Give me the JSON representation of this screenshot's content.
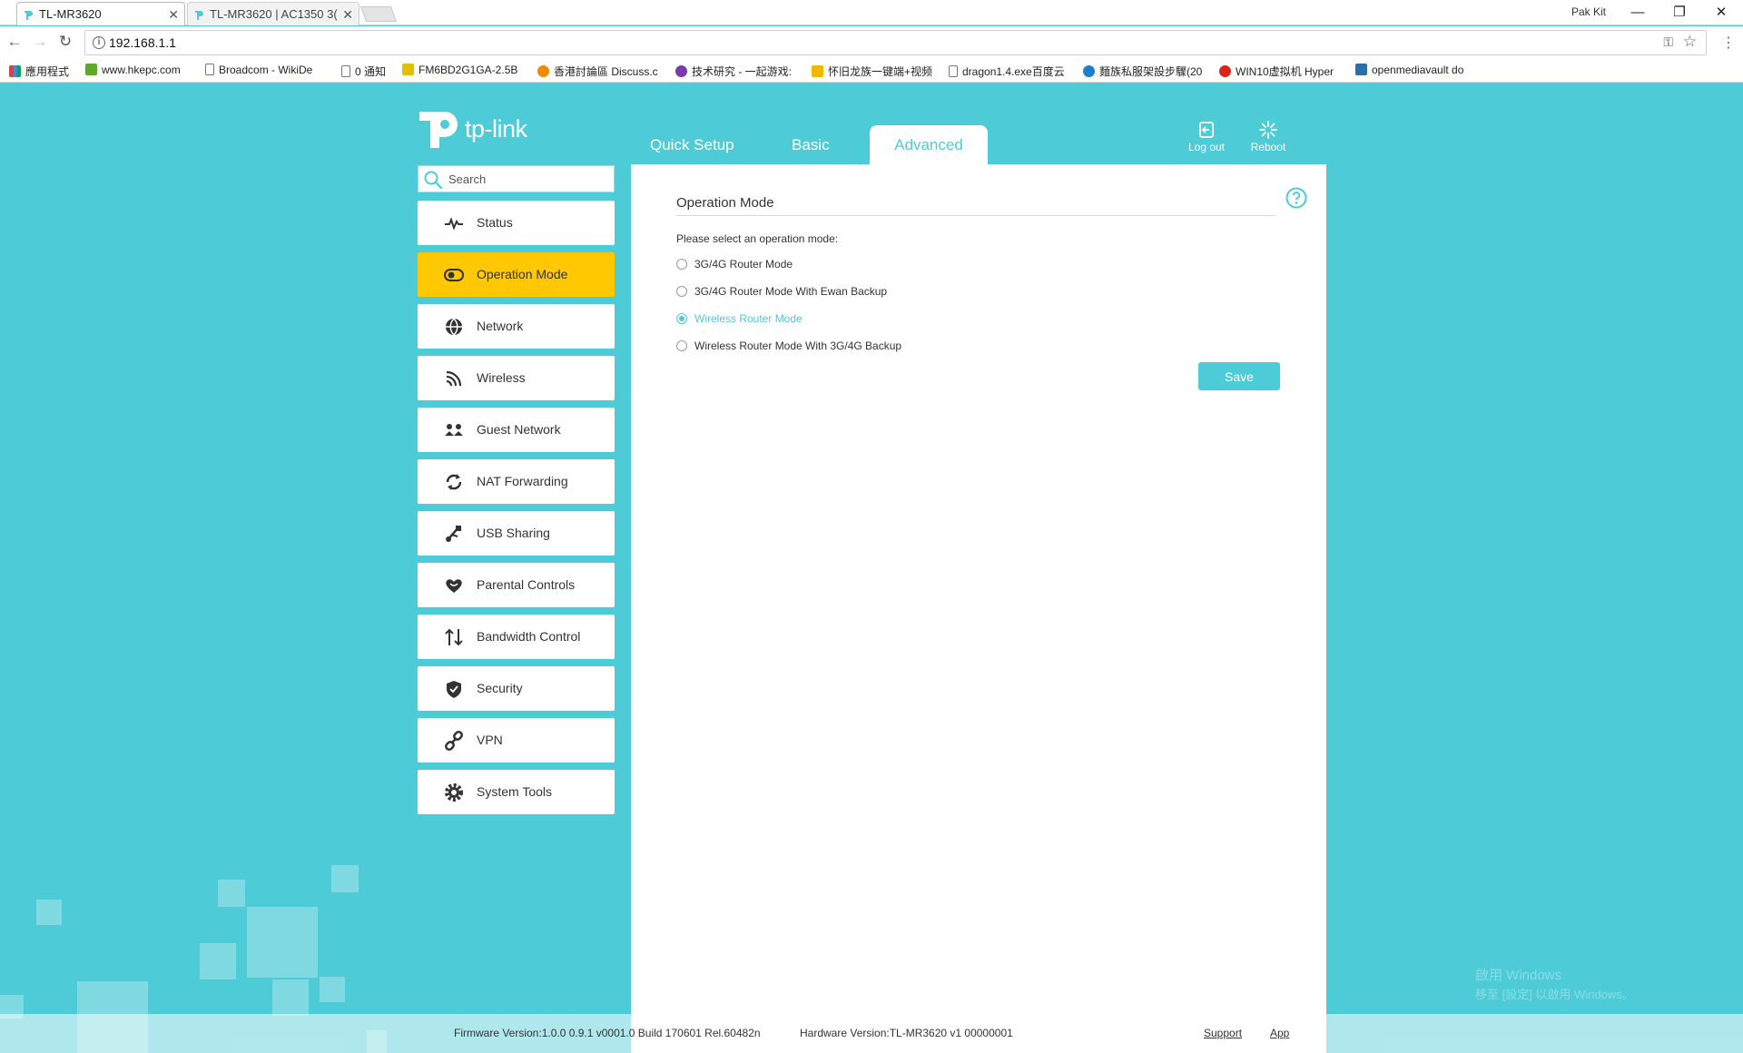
{
  "browser": {
    "tabs": [
      {
        "title": "TL-MR3620",
        "active": true
      },
      {
        "title": "TL-MR3620 | AC1350 3(",
        "active": false
      }
    ],
    "user": "Pak Kit",
    "url": "192.168.1.1",
    "bookmarks": [
      {
        "label": "應用程式",
        "icon": "apps-grid-icon",
        "color": "#d14836"
      },
      {
        "label": "www.hkepc.com",
        "icon": "hkepc-icon",
        "color": "#5fa82e"
      },
      {
        "label": "Broadcom - WikiDe",
        "icon": "page-icon",
        "color": "#ffffff"
      },
      {
        "label": "0 通知",
        "icon": "page-icon",
        "color": "#ffffff"
      },
      {
        "label": "FM6BD2G1GA-2.5B",
        "icon": "chip-icon",
        "color": "#e0c000"
      },
      {
        "label": "香港討論區 Discuss.c",
        "icon": "discuss-icon",
        "color": "#f08a00"
      },
      {
        "label": "技术研究 - 一起游戏:",
        "icon": "game-icon",
        "color": "#7a3aa8"
      },
      {
        "label": "怀旧龙族一键端+视频",
        "icon": "dragon-icon",
        "color": "#f0b800"
      },
      {
        "label": "dragon1.4.exe百度云",
        "icon": "page-icon",
        "color": "#ffffff"
      },
      {
        "label": "麵族私服架設步驟(20",
        "icon": "puzzle-icon",
        "color": "#1a7fd1"
      },
      {
        "label": "WIN10虚拟机 Hyper",
        "icon": "weibo-icon",
        "color": "#d9261c"
      },
      {
        "label": "openmediavault do",
        "icon": "sf-icon",
        "color": "#2a6ea8"
      }
    ]
  },
  "header": {
    "brand": "tp-link",
    "nav": {
      "quick_setup": "Quick Setup",
      "basic": "Basic",
      "advanced": "Advanced"
    },
    "logout": "Log out",
    "reboot": "Reboot"
  },
  "search": {
    "placeholder": "Search"
  },
  "sidebar": {
    "items": [
      {
        "label": "Status",
        "icon": "pulse-icon",
        "active": false
      },
      {
        "label": "Operation Mode",
        "icon": "toggle-icon",
        "active": true
      },
      {
        "label": "Network",
        "icon": "globe-icon",
        "active": false
      },
      {
        "label": "Wireless",
        "icon": "wifi-icon",
        "active": false
      },
      {
        "label": "Guest Network",
        "icon": "guest-icon",
        "active": false
      },
      {
        "label": "NAT Forwarding",
        "icon": "nat-icon",
        "active": false
      },
      {
        "label": "USB Sharing",
        "icon": "usb-icon",
        "active": false
      },
      {
        "label": "Parental Controls",
        "icon": "heart-icon",
        "active": false
      },
      {
        "label": "Bandwidth Control",
        "icon": "bandwidth-icon",
        "active": false
      },
      {
        "label": "Security",
        "icon": "shield-icon",
        "active": false
      },
      {
        "label": "VPN",
        "icon": "link-icon",
        "active": false
      },
      {
        "label": "System Tools",
        "icon": "gear-icon",
        "active": false
      }
    ]
  },
  "main": {
    "title": "Operation Mode",
    "prompt": "Please select an operation mode:",
    "options": [
      {
        "label": "3G/4G Router Mode",
        "checked": false
      },
      {
        "label": "3G/4G Router Mode With Ewan Backup",
        "checked": false
      },
      {
        "label": "Wireless Router Mode",
        "checked": true
      },
      {
        "label": "Wireless Router Mode With 3G/4G Backup",
        "checked": false
      }
    ],
    "save": "Save"
  },
  "footer": {
    "firmware": "Firmware Version:1.0.0 0.9.1 v0001.0 Build 170601 Rel.60482n",
    "hardware": "Hardware Version:TL-MR3620 v1 00000001",
    "support": "Support",
    "app": "App"
  },
  "watermark": {
    "line1": "啟用 Windows",
    "line2": "移至 [設定] 以啟用 Windows。"
  },
  "colors": {
    "accent": "#4dcbd6",
    "active_menu": "#ffc800"
  }
}
